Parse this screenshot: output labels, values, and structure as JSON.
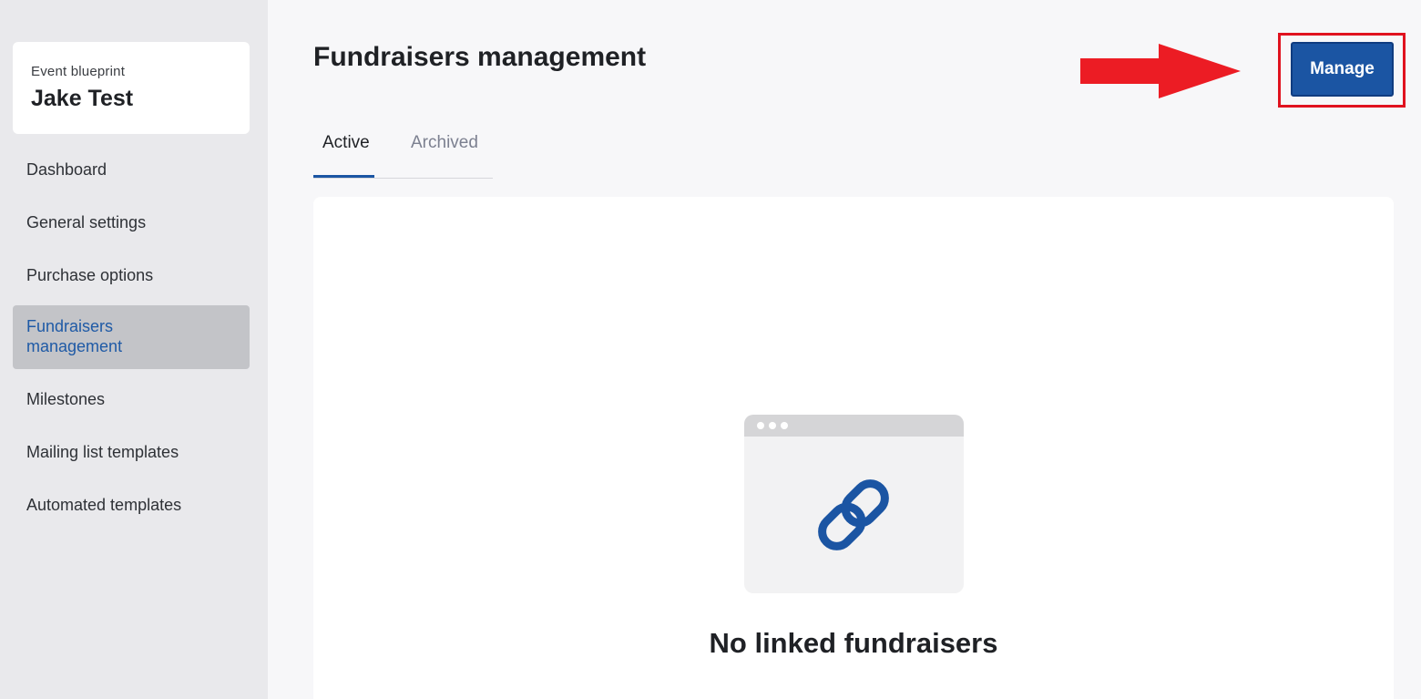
{
  "sidebar": {
    "event_label": "Event blueprint",
    "event_name": "Jake Test",
    "items": [
      {
        "label": "Dashboard"
      },
      {
        "label": "General settings"
      },
      {
        "label": "Purchase options"
      },
      {
        "label": "Fundraisers\nmanagement",
        "active": true
      },
      {
        "label": "Milestones"
      },
      {
        "label": "Mailing list templates"
      },
      {
        "label": "Automated templates"
      }
    ]
  },
  "header": {
    "title": "Fundraisers management",
    "manage_label": "Manage"
  },
  "tabs": [
    {
      "label": "Active",
      "active": true
    },
    {
      "label": "Archived",
      "active": false
    }
  ],
  "empty_state": {
    "icon": "link-icon",
    "title": "No linked fundraisers"
  },
  "colors": {
    "accent": "#1b55a3",
    "annotation": "#e0121f"
  }
}
